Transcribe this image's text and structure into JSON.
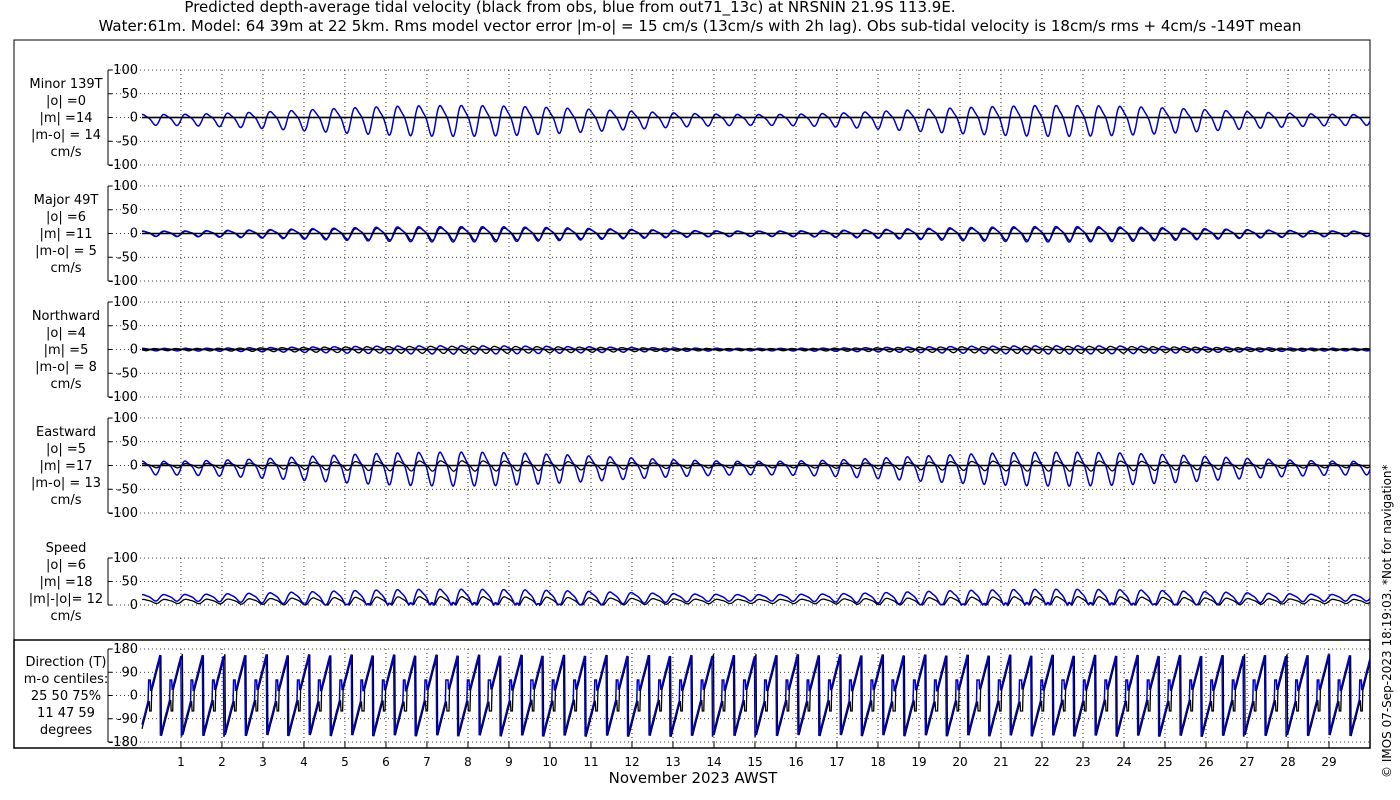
{
  "title_line1": "Predicted depth-average tidal velocity (black from obs, blue from out71_13c) at NRSNIN 21.9S 113.9E.",
  "title_line2": "Water:61m. Model: 64 39m at 22 5km. Rms model vector error |m-o| = 15 cm/s (13cm/s with 2h lag). Obs sub-tidal velocity is 18cm/s rms + 4cm/s -149T mean",
  "xlabel": "November 2023 AWST",
  "copyright": "© IMOS 07-Sep-2023 18:19:03. *Not for navigation*",
  "colors": {
    "obs": "#000000",
    "model": "#0000cc",
    "grid": "#000000"
  },
  "chart_data": [
    {
      "type": "line",
      "id": "minor",
      "label_lines": [
        "Minor 139T",
        "|o| =0",
        "|m| =14",
        "|m-o| = 14",
        "cm/s"
      ],
      "ylim": [
        -100,
        100
      ],
      "yticks": [
        "100",
        "50",
        "0",
        "-50",
        "-100"
      ],
      "series": [
        {
          "role": "obs",
          "amplitude": 0,
          "offset": 0,
          "spring_mod": 0.5,
          "phase": 0
        },
        {
          "role": "model",
          "amplitude": 30,
          "offset": -4,
          "spring_mod": 0.65,
          "phase": 0.3
        }
      ]
    },
    {
      "type": "line",
      "id": "major",
      "label_lines": [
        "Major 49T",
        "|o| =6",
        "|m| =11",
        "|m-o| = 5",
        "cm/s"
      ],
      "ylim": [
        -100,
        100
      ],
      "yticks": [
        "100",
        "50",
        "0",
        "-50",
        "-100"
      ],
      "series": [
        {
          "role": "obs",
          "amplitude": 12,
          "offset": 0,
          "spring_mod": 0.6,
          "phase": 0.1
        },
        {
          "role": "model",
          "amplitude": 15,
          "offset": 0,
          "spring_mod": 0.65,
          "phase": 0.3
        }
      ]
    },
    {
      "type": "line",
      "id": "northward",
      "label_lines": [
        "Northward",
        "|o| =4",
        "|m| =5",
        "|m-o| = 8",
        "cm/s"
      ],
      "ylim": [
        -100,
        100
      ],
      "yticks": [
        "100",
        "50",
        "0",
        "-50",
        "-100"
      ],
      "series": [
        {
          "role": "obs",
          "amplitude": 7,
          "offset": 0,
          "spring_mod": 0.7,
          "phase": 3.1
        },
        {
          "role": "model",
          "amplitude": 8,
          "offset": 0,
          "spring_mod": 0.7,
          "phase": 0.2
        }
      ]
    },
    {
      "type": "line",
      "id": "eastward",
      "label_lines": [
        "Eastward",
        "|o| =5",
        "|m| =17",
        "|m-o| = 13",
        "cm/s"
      ],
      "ylim": [
        -100,
        100
      ],
      "yticks": [
        "100",
        "50",
        "0",
        "-50",
        "-100"
      ],
      "series": [
        {
          "role": "obs",
          "amplitude": 10,
          "offset": 0,
          "spring_mod": 0.6,
          "phase": 0.1
        },
        {
          "role": "model",
          "amplitude": 33,
          "offset": -4,
          "spring_mod": 0.6,
          "phase": 0.3
        }
      ]
    },
    {
      "type": "line",
      "id": "speed",
      "label_lines": [
        "Speed",
        "|o| =6",
        "|m| =18",
        "|m|-|o|= 12",
        "cm/s"
      ],
      "ylim": [
        0,
        100
      ],
      "yticks": [
        "100",
        "50",
        "0"
      ],
      "series": [
        {
          "role": "obs",
          "amplitude": 10,
          "offset": 8,
          "spring_mod": 0.6,
          "phase": 0.1
        },
        {
          "role": "model",
          "amplitude": 18,
          "offset": 16,
          "spring_mod": 0.65,
          "phase": 0.3
        }
      ]
    },
    {
      "type": "line",
      "id": "direction",
      "label_lines": [
        "Direction (T)",
        "m-o centiles:",
        "25  50  75%",
        "11  47  59",
        "degrees"
      ],
      "ylim": [
        -180,
        180
      ],
      "yticks": [
        "180",
        "90",
        "0",
        "-90",
        "-180"
      ],
      "series": [
        {
          "role": "obs",
          "pattern": "sawtooth"
        },
        {
          "role": "model",
          "pattern": "sawtooth"
        }
      ]
    }
  ],
  "x_axis": {
    "days": [
      "1",
      "2",
      "3",
      "4",
      "5",
      "6",
      "7",
      "8",
      "9",
      "10",
      "11",
      "12",
      "13",
      "14",
      "15",
      "16",
      "17",
      "18",
      "19",
      "20",
      "21",
      "22",
      "23",
      "24",
      "25",
      "26",
      "27",
      "28",
      "29"
    ],
    "xlim_days": [
      0.05,
      30.0
    ],
    "cycles_per_day": 1.93
  }
}
